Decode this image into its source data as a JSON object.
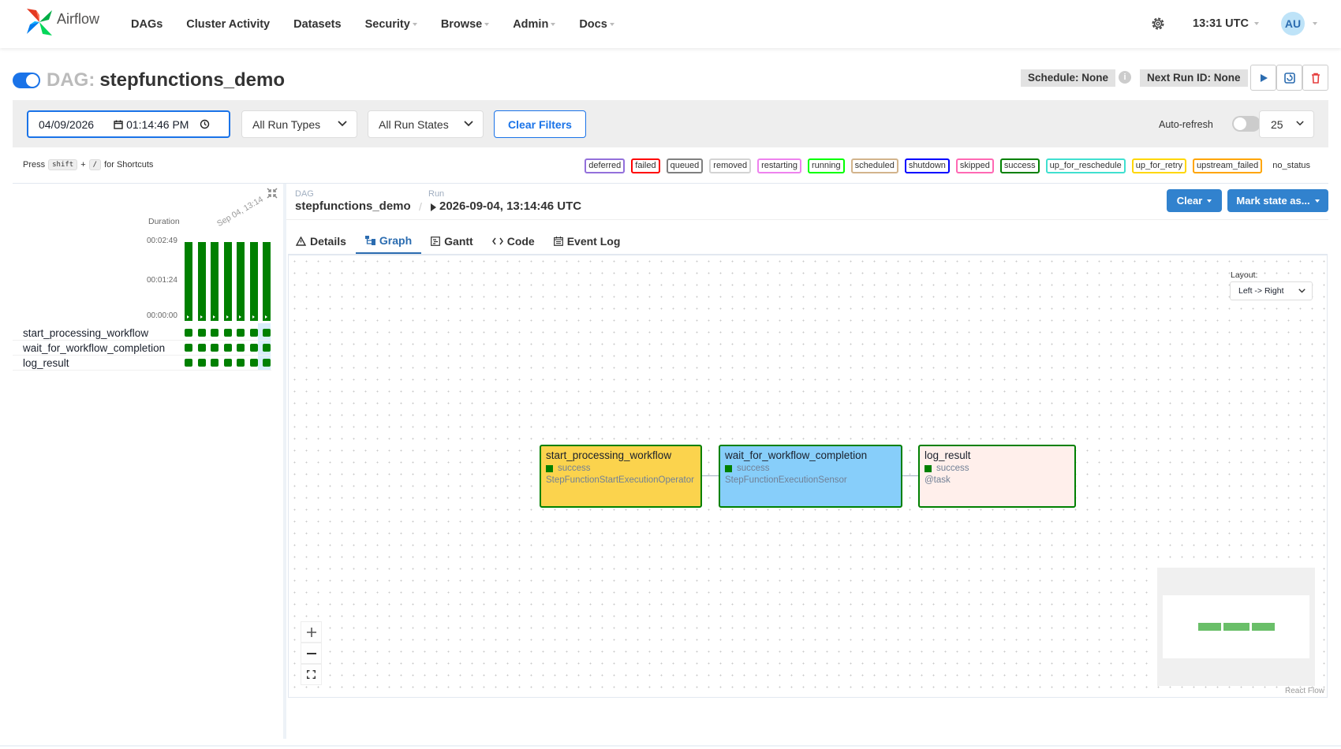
{
  "nav": {
    "brand": "Airflow",
    "links": [
      {
        "label": "DAGs",
        "dropdown": false
      },
      {
        "label": "Cluster Activity",
        "dropdown": false
      },
      {
        "label": "Datasets",
        "dropdown": false
      },
      {
        "label": "Security",
        "dropdown": true
      },
      {
        "label": "Browse",
        "dropdown": true
      },
      {
        "label": "Admin",
        "dropdown": true
      },
      {
        "label": "Docs",
        "dropdown": true
      }
    ],
    "time": "13:31 UTC",
    "avatar": "AU"
  },
  "dag": {
    "prefix": "DAG:",
    "name": "stepfunctions_demo",
    "schedule": "Schedule: None",
    "next_run": "Next Run ID: None"
  },
  "filters": {
    "date": "04/09/2026",
    "time": "01:14:46 PM",
    "run_types": "All Run Types",
    "run_states": "All Run States",
    "clear_label": "Clear Filters",
    "autorefresh_label": "Auto-refresh",
    "page_size": "25"
  },
  "shortcut": {
    "press": "Press",
    "key1": "shift",
    "plus": "+",
    "key2": "/",
    "suffix": "for Shortcuts"
  },
  "legend": [
    {
      "label": "deferred",
      "color": "#9370db"
    },
    {
      "label": "failed",
      "color": "#ff0000"
    },
    {
      "label": "queued",
      "color": "#808080"
    },
    {
      "label": "removed",
      "color": "#d3d3d3"
    },
    {
      "label": "restarting",
      "color": "#ee82ee"
    },
    {
      "label": "running",
      "color": "#00ff00"
    },
    {
      "label": "scheduled",
      "color": "#d2b48c"
    },
    {
      "label": "shutdown",
      "color": "#0000ff"
    },
    {
      "label": "skipped",
      "color": "#ff69b4"
    },
    {
      "label": "success",
      "color": "#008000"
    },
    {
      "label": "up_for_reschedule",
      "color": "#40e0d0"
    },
    {
      "label": "up_for_retry",
      "color": "#ffd700"
    },
    {
      "label": "upstream_failed",
      "color": "#ffa500"
    },
    {
      "label": "no_status",
      "color": ""
    }
  ],
  "grid": {
    "duration_label": "Duration",
    "date_label": "Sep 04, 13:14",
    "y_ticks": [
      "00:02:49",
      "00:01:24",
      "00:00:00"
    ],
    "tasks": [
      "start_processing_workflow",
      "wait_for_workflow_completion",
      "log_result"
    ]
  },
  "detail": {
    "dag_label": "DAG",
    "dag_value": "stepfunctions_demo",
    "run_label": "Run",
    "run_value": "2026-09-04, 13:14:46 UTC",
    "clear_btn": "Clear",
    "mark_btn": "Mark state as...",
    "tabs": [
      "Details",
      "Graph",
      "Gantt",
      "Code",
      "Event Log"
    ],
    "active_tab": "Graph",
    "layout_label": "Layout:",
    "layout_value": "Left -> Right",
    "react_flow": "React Flow"
  },
  "graph": {
    "nodes": [
      {
        "title": "start_processing_workflow",
        "state": "success",
        "operator": "StepFunctionStartExecutionOperator",
        "color": "#fbd34d"
      },
      {
        "title": "wait_for_workflow_completion",
        "state": "success",
        "operator": "StepFunctionExecutionSensor",
        "color": "#87cefa"
      },
      {
        "title": "log_result",
        "state": "success",
        "operator": "@task",
        "color": "#ffefeb"
      }
    ]
  }
}
